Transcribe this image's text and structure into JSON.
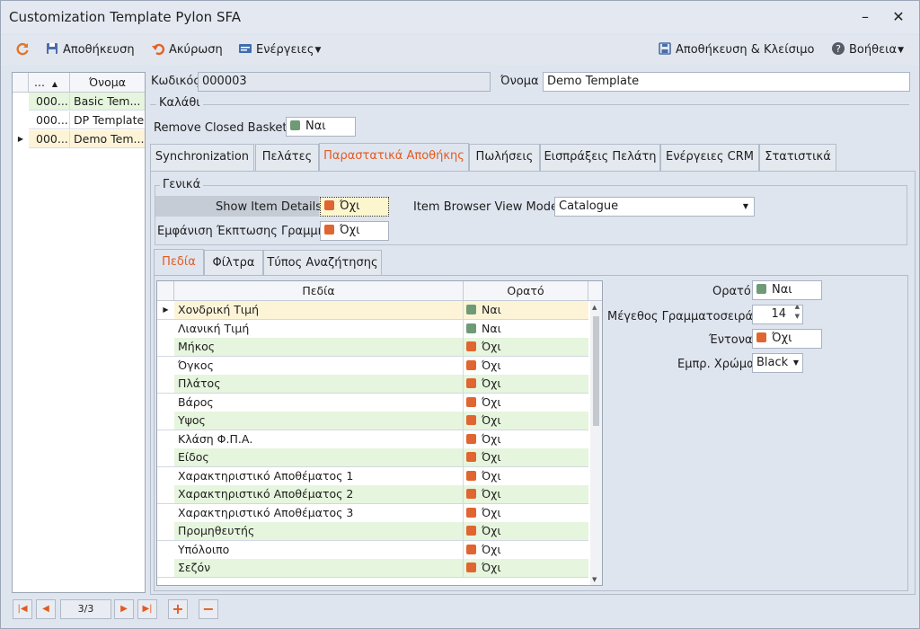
{
  "window": {
    "title": "Customization Template Pylon SFA",
    "minimize": "–",
    "close": "✕"
  },
  "toolbar": {
    "save": "Αποθήκευση",
    "cancel": "Ακύρωση",
    "actions": "Ενέργειες",
    "save_close": "Αποθήκευση & Κλείσιμο",
    "help": "Βοήθεια"
  },
  "left_grid": {
    "col1": "...",
    "col2": "Όνομα",
    "rows": [
      {
        "code": "000...",
        "name": "Basic Tem..."
      },
      {
        "code": "000...",
        "name": "DP Template"
      },
      {
        "code": "000...",
        "name": "Demo Tem..."
      }
    ]
  },
  "form": {
    "code_label": "Κωδικός",
    "code_value": "000003",
    "name_label": "Όνομα",
    "name_value": "Demo Template"
  },
  "basket": {
    "title": "Καλάθι",
    "remove_label": "Remove Closed Baskets",
    "remove_value": "Ναι"
  },
  "tabs": [
    "Synchronization",
    "Πελάτες",
    "Παραστατικά Αποθήκης",
    "Πωλήσεις",
    "Εισπράξεις Πελάτη",
    "Ενέργειες CRM",
    "Στατιστικά"
  ],
  "general": {
    "title": "Γενικά",
    "show_details_label": "Show Item Details",
    "show_details_value": "Όχι",
    "discount_label": "Εμφάνιση Έκπτωσης Γραμμής",
    "discount_value": "Όχι",
    "browser_label": "Item Browser View Mode",
    "browser_value": "Catalogue"
  },
  "subtabs": [
    "Πεδία",
    "Φίλτρα",
    "Τύπος Αναζήτησης"
  ],
  "fields_grid": {
    "col1": "Πεδία",
    "col2": "Ορατό",
    "rows": [
      {
        "name": "Χονδρική Τιμή",
        "visible": "Ναι"
      },
      {
        "name": "Λιανική Τιμή",
        "visible": "Ναι"
      },
      {
        "name": "Μήκος",
        "visible": "Όχι"
      },
      {
        "name": "Όγκος",
        "visible": "Όχι"
      },
      {
        "name": "Πλάτος",
        "visible": "Όχι"
      },
      {
        "name": "Βάρος",
        "visible": "Όχι"
      },
      {
        "name": "Υψος",
        "visible": "Όχι"
      },
      {
        "name": "Κλάση Φ.Π.Α.",
        "visible": "Όχι"
      },
      {
        "name": "Είδος",
        "visible": "Όχι"
      },
      {
        "name": "Χαρακτηριστικό Αποθέματος 1",
        "visible": "Όχι"
      },
      {
        "name": "Χαρακτηριστικό Αποθέματος 2",
        "visible": "Όχι"
      },
      {
        "name": "Χαρακτηριστικό Αποθέματος 3",
        "visible": "Όχι"
      },
      {
        "name": "Προμηθευτής",
        "visible": "Όχι"
      },
      {
        "name": "Υπόλοιπο",
        "visible": "Όχι"
      },
      {
        "name": "Σεζόν",
        "visible": "Όχι"
      }
    ]
  },
  "props": {
    "visible_label": "Ορατό",
    "visible_value": "Ναι",
    "font_label": "Μέγεθος Γραμματοσειράς",
    "font_value": "14",
    "bold_label": "Έντονα",
    "bold_value": "Όχι",
    "color_label": "Εμπρ. Χρώμα",
    "color_value": "Black"
  },
  "nav": {
    "position": "3/3"
  },
  "colors": {
    "accent": "#e25b1f",
    "row_green": "#e6f5dd",
    "row_selected": "#fdf4d8"
  }
}
